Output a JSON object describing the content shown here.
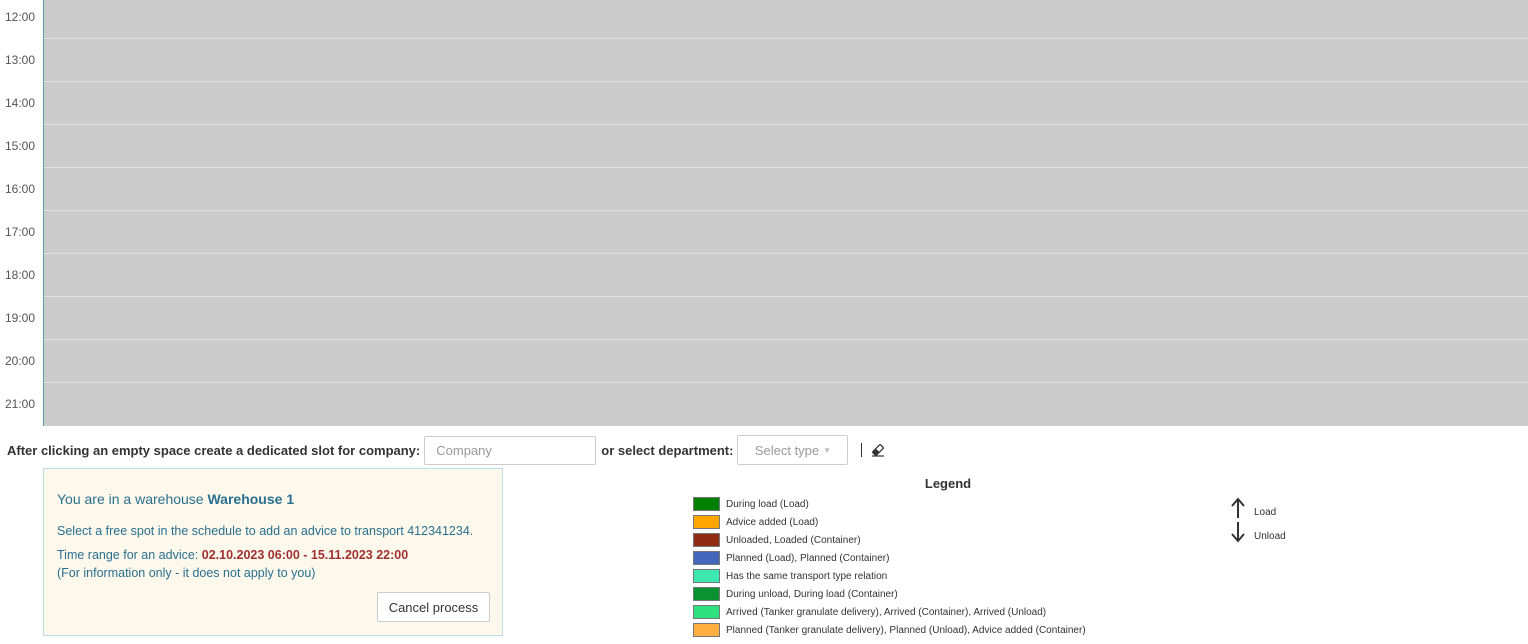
{
  "schedule": {
    "hours": [
      "12:00",
      "13:00",
      "14:00",
      "15:00",
      "16:00",
      "17:00",
      "18:00",
      "19:00",
      "20:00",
      "21:00"
    ]
  },
  "filter": {
    "company_label": "After clicking an empty space create a dedicated slot for company:",
    "company_placeholder": "Company",
    "or_label": "or select department:",
    "department_placeholder": "Select type"
  },
  "info": {
    "title_prefix": "You are in a warehouse",
    "warehouse_name": "Warehouse 1",
    "select_text": "Select a free spot in the schedule to add an advice to transport 412341234.",
    "range_label": "Time range for an advice:",
    "range_value": "02.10.2023 06:00 - 15.11.2023 22:00",
    "note": "(For information only - it does not apply to you)",
    "cancel_label": "Cancel process"
  },
  "legend": {
    "title": "Legend",
    "items": [
      {
        "label": "During load (Load)",
        "color": "#008000"
      },
      {
        "label": "Advice added (Load)",
        "color": "#ffa500"
      },
      {
        "label": "Unloaded, Loaded (Container)",
        "color": "#922b14"
      },
      {
        "label": "Planned (Load), Planned (Container)",
        "color": "#4466bb"
      },
      {
        "label": "Has the same transport type relation",
        "color": "#3de8b0"
      },
      {
        "label": "During unload, During load (Container)",
        "color": "#0a9130"
      },
      {
        "label": "Arrived (Tanker granulate delivery), Arrived (Container), Arrived (Unload)",
        "color": "#2ee07e"
      },
      {
        "label": "Planned (Tanker granulate delivery), Planned (Unload), Advice added (Container)",
        "color": "#ffae40"
      }
    ],
    "directions": {
      "load_label": "Load",
      "unload_label": "Unload"
    }
  }
}
